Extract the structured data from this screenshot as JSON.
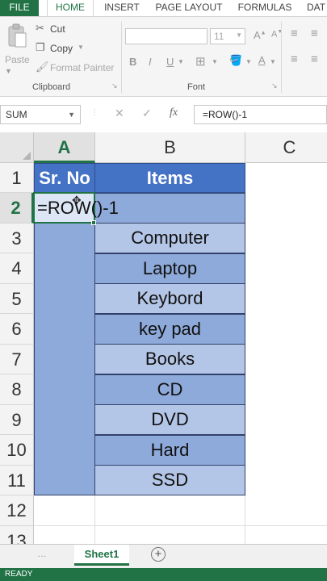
{
  "ribbon": {
    "tabs": [
      "FILE",
      "HOME",
      "INSERT",
      "PAGE LAYOUT",
      "FORMULAS",
      "DAT"
    ],
    "paste_label": "Paste",
    "cut_label": "Cut",
    "copy_label": "Copy",
    "format_painter_label": "Format Painter",
    "clipboard_group": "Clipboard",
    "font_group": "Font",
    "font_size": "11",
    "bold": "B",
    "italic": "I",
    "underline": "U",
    "font_color_glyph": "A"
  },
  "formula_bar": {
    "name_box": "SUM",
    "cancel": "✕",
    "enter": "✓",
    "fx": "fx",
    "formula": "=ROW()-1"
  },
  "sheet": {
    "columns": [
      "A",
      "B",
      "C"
    ],
    "selected_column": "A",
    "rows": [
      "1",
      "2",
      "3",
      "4",
      "5",
      "6",
      "7",
      "8",
      "9",
      "10",
      "11",
      "12",
      "13"
    ],
    "selected_row": "2",
    "headers": {
      "sr_no": "Sr. No",
      "items": "Items"
    },
    "active_cell_content": "=ROW()-1",
    "items": [
      "Computer",
      "Laptop",
      "Keybord",
      "key pad",
      "Books",
      "CD",
      "DVD",
      "Hard",
      "SSD"
    ]
  },
  "sheet_tabs": {
    "active": "Sheet1",
    "add": "+"
  },
  "status_bar": {
    "text": "READY"
  },
  "colors": {
    "accent": "#217346",
    "header_fill": "#4472c4",
    "band_light": "#b4c6e7",
    "band_dark": "#8eaadb"
  }
}
